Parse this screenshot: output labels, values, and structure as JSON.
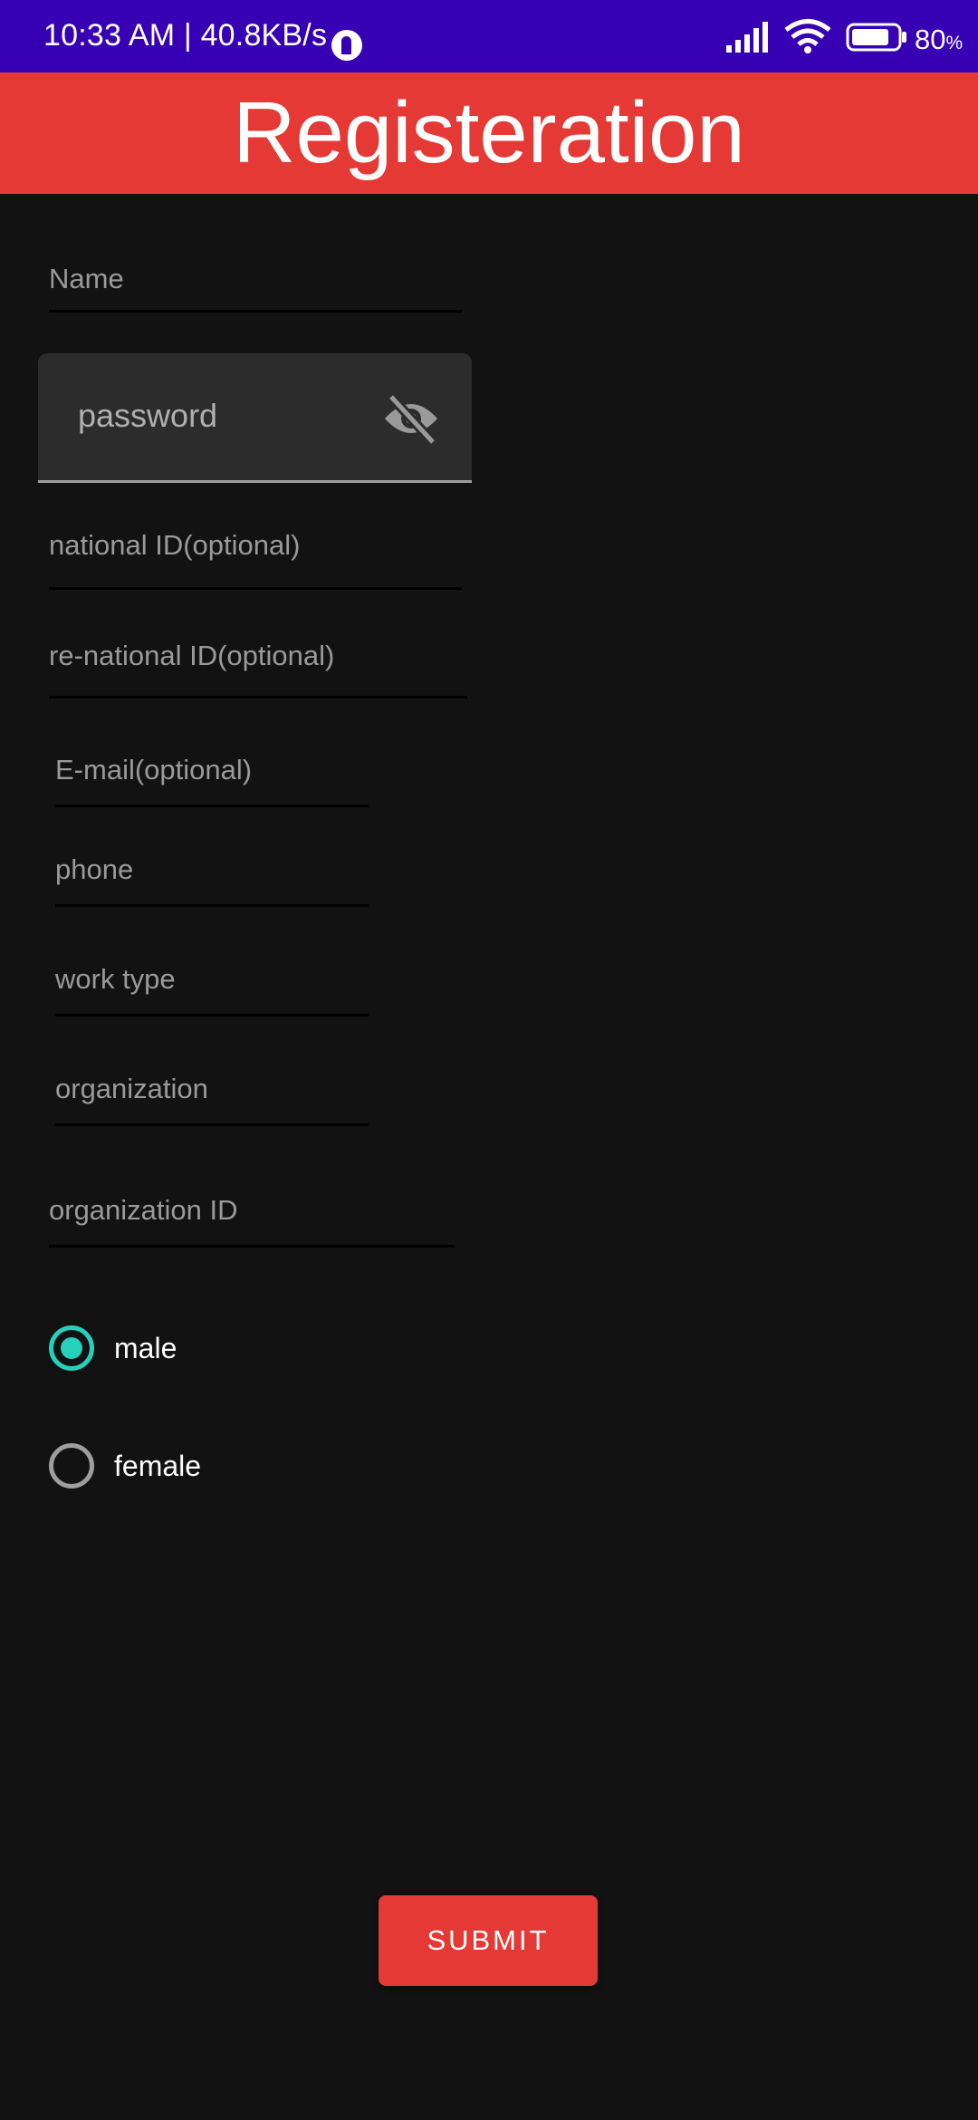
{
  "status_bar": {
    "time_speed": "10:33 AM | 40.8KB/s",
    "battery_percent": "80",
    "battery_unit": "%",
    "color": "#3700b3",
    "icons": [
      "notification-badge-icon",
      "signal-icon",
      "wifi-icon",
      "battery-icon"
    ]
  },
  "header": {
    "title": "Registeration",
    "color": "#e53935"
  },
  "form": {
    "name_placeholder": "Name",
    "password_placeholder": "password",
    "national_id_placeholder": "national ID(optional)",
    "re_national_id_placeholder": "re-national ID(optional)",
    "email_placeholder": "E-mail(optional)",
    "phone_placeholder": "phone",
    "work_type_placeholder": "work type",
    "organization_placeholder": "organization",
    "organization_id_placeholder": "organization ID"
  },
  "gender": {
    "options": [
      "male",
      "female"
    ],
    "selected": "male",
    "accent_color": "#26d0ba"
  },
  "submit": {
    "label": "SUBMIT",
    "color": "#e53935"
  }
}
